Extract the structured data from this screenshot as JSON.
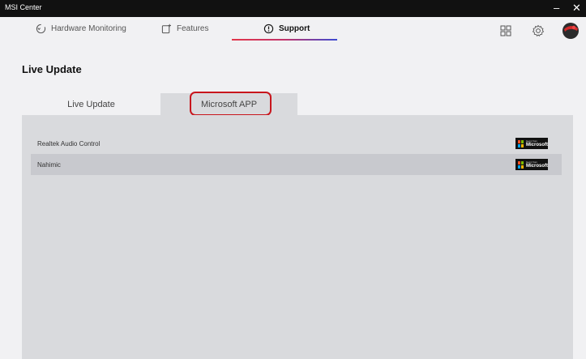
{
  "window": {
    "title": "MSI Center",
    "minimize": "–",
    "close": "✕"
  },
  "nav": {
    "items": [
      {
        "label": "Hardware Monitoring",
        "icon": "refresh-circle-icon"
      },
      {
        "label": "Features",
        "icon": "square-plus-icon"
      },
      {
        "label": "Support",
        "icon": "alert-circle-icon",
        "active": true
      }
    ],
    "right_icons": [
      "grid-icon",
      "settings-icon",
      "avatar-icon"
    ]
  },
  "page": {
    "title": "Live Update"
  },
  "tabs": [
    {
      "label": "Live Update",
      "active": false
    },
    {
      "label": "Microsoft APP",
      "active": true
    }
  ],
  "apps": [
    {
      "name": "Realtek Audio Control",
      "badge_small": "Get it from",
      "badge_big": "Microsoft",
      "selected": false
    },
    {
      "name": "Nahimic",
      "badge_small": "Get it from",
      "badge_big": "Microsoft",
      "selected": true
    }
  ],
  "colors": {
    "highlight_border": "#c8161d",
    "ms_red": "#f25022",
    "ms_green": "#7fba00",
    "ms_blue": "#00a4ef",
    "ms_yellow": "#ffb900"
  }
}
